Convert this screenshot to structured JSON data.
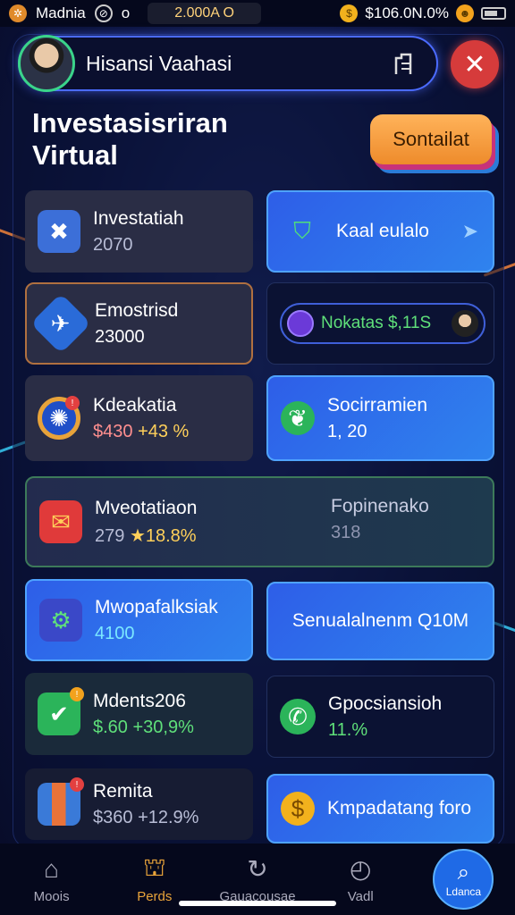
{
  "status_bar": {
    "app_name": "Madnia",
    "signal": "o",
    "balance_center": "2.000A O",
    "balance_right": "$106.0N.0%"
  },
  "header": {
    "username": "Hisansi Vaahasi",
    "cta_label": "Sontailat",
    "title_line1": "Investasisriran",
    "title_line2": "Virtual"
  },
  "cards": [
    {
      "title": "Investatiah",
      "value": "2070",
      "icon": "crossed-tools-icon"
    },
    {
      "title": "Kaal eulalo",
      "value": "",
      "icon": "shield-check-icon"
    },
    {
      "title": "Emostrisd",
      "value": "23000",
      "icon": "plane-icon"
    },
    {
      "title": "Nokatas $,11S",
      "value": "",
      "icon": "coin-icon"
    },
    {
      "title": "Kdeakatia",
      "value": "$430",
      "change": "+43 %",
      "icon": "wheel-icon"
    },
    {
      "title": "Socirramien",
      "value": "1, 20",
      "icon": "leaf-icon"
    },
    {
      "title": "Mveotatiaon",
      "value": "279",
      "change": "★18.8%",
      "side_title": "Fopinenako",
      "side_value": "318",
      "icon": "envelope-icon"
    },
    {
      "title": "Mwopafalksiak",
      "value": "4100",
      "icon": "gear-icon"
    },
    {
      "title": "Senualalnenm Q10M",
      "value": "",
      "icon": ""
    },
    {
      "title": "Mdents206",
      "value": "$.60",
      "change": "+30,9%",
      "icon": "check-icon"
    },
    {
      "title": "Gpocsiansioh",
      "value": "11.%",
      "icon": "chat-icon"
    },
    {
      "title": "Remita",
      "value": "$360",
      "change": "+12.9%",
      "icon": "bars-icon"
    },
    {
      "title": "Kmpadatang foro",
      "value": "",
      "icon": "coin-icon"
    }
  ],
  "bottom_nav": [
    {
      "label": "Moois",
      "icon": "home-icon"
    },
    {
      "label": "Perds",
      "icon": "bank-icon"
    },
    {
      "label": "Gauacousae",
      "icon": "refresh-icon"
    },
    {
      "label": "Vadl",
      "icon": "clock-icon"
    },
    {
      "label": "Ldanca",
      "icon": "search-icon"
    }
  ]
}
